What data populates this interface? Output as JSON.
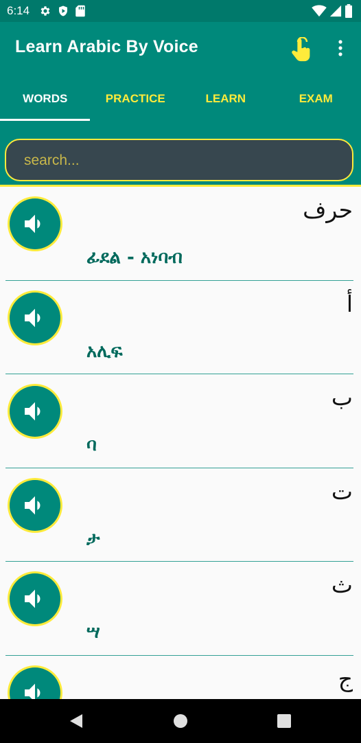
{
  "status_bar": {
    "time": "6:14",
    "left_icons": [
      "gear-icon",
      "shield-icon",
      "sd-card-icon"
    ],
    "right_icons": [
      "wifi-icon",
      "signal-icon",
      "battery-icon"
    ]
  },
  "app_bar": {
    "title": "Learn Arabic By Voice",
    "actions": [
      "touch-hand-icon",
      "more-vert-icon"
    ]
  },
  "tabs": [
    {
      "label": "WORDS",
      "active": true
    },
    {
      "label": "PRACTICE",
      "active": false
    },
    {
      "label": "LEARN",
      "active": false
    },
    {
      "label": "EXAM",
      "active": false
    }
  ],
  "search": {
    "placeholder": "search...",
    "value": ""
  },
  "list": {
    "items": [
      {
        "arabic": "حرف",
        "amharic": "ፊደል - አነባብ"
      },
      {
        "arabic": "أ",
        "amharic": "አሊፍ"
      },
      {
        "arabic": "ب",
        "amharic": "ባ"
      },
      {
        "arabic": "ت",
        "amharic": "ታ"
      },
      {
        "arabic": "ث",
        "amharic": "ሣ"
      },
      {
        "arabic": "ج",
        "amharic": ""
      }
    ]
  },
  "colors": {
    "status_bar": "#00796b",
    "primary": "#00897b",
    "accent": "#ffeb3b",
    "search_bg": "#37474f",
    "amharic_text": "#00695c"
  },
  "nav_bar": {
    "buttons": [
      "back-icon",
      "home-icon",
      "recents-icon"
    ]
  }
}
